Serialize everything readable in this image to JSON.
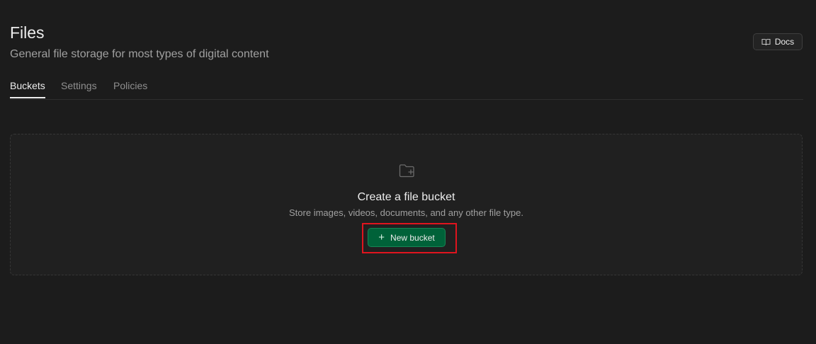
{
  "header": {
    "title": "Files",
    "subtitle": "General file storage for most types of digital content",
    "docs_button": {
      "label": "Docs",
      "icon": "book-open-icon"
    }
  },
  "tabs": [
    {
      "label": "Buckets",
      "active": true
    },
    {
      "label": "Settings",
      "active": false
    },
    {
      "label": "Policies",
      "active": false
    }
  ],
  "empty_state": {
    "icon": "folder-plus-icon",
    "title": "Create a file bucket",
    "description": "Store images, videos, documents, and any other file type.",
    "action_button": {
      "label": "New bucket",
      "icon": "plus-icon"
    }
  },
  "colors": {
    "background": "#1c1c1c",
    "brand_button": "#006239",
    "highlight": "#e0141e"
  }
}
